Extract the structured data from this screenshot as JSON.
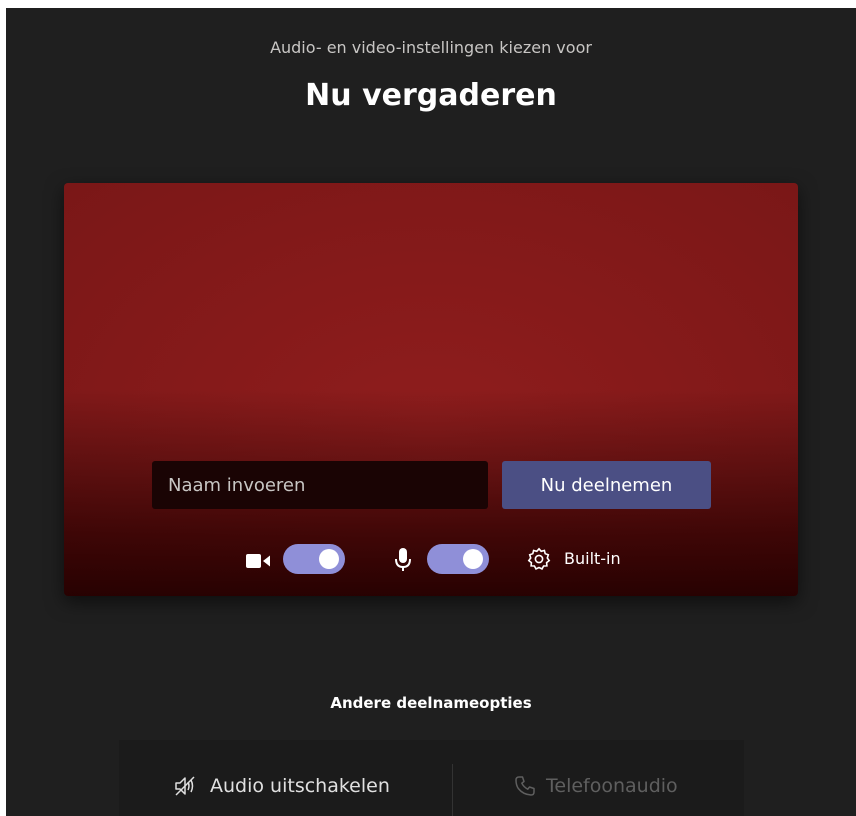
{
  "header": {
    "subtitle": "Audio- en video-instellingen kiezen voor",
    "title": "Nu vergaderen"
  },
  "preview": {
    "name_input": {
      "placeholder": "Naam invoeren",
      "value": ""
    },
    "join_button_label": "Nu deelnemen",
    "camera_toggle": {
      "icon": "camera-icon",
      "state": "on"
    },
    "mic_toggle": {
      "icon": "microphone-icon",
      "state": "on"
    },
    "device_settings": {
      "icon": "gear-icon",
      "label": "Built-in"
    }
  },
  "other_options": {
    "title": "Andere deelnameopties",
    "audio_off_label": "Audio uitschakelen",
    "audio_off_icon": "speaker-off-icon",
    "phone_audio_label": "Telefoonaudio",
    "phone_audio_icon": "phone-icon"
  },
  "colors": {
    "background": "#1f1f1f",
    "accent": "#4b4f84",
    "toggle_on": "#8f8fd8",
    "preview_red": "#8f1d1d"
  }
}
